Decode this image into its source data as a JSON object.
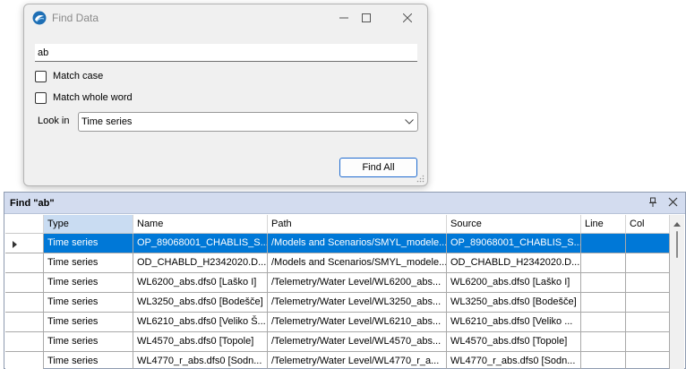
{
  "dialog": {
    "title": "Find Data",
    "search_value": "ab",
    "match_case_label": "Match case",
    "match_whole_word_label": "Match whole word",
    "look_in_label": "Look in",
    "look_in_value": "Time series",
    "find_all_label": "Find All"
  },
  "panel": {
    "title": "Find \"ab\"",
    "columns": [
      "Type",
      "Name",
      "Path",
      "Source",
      "Line",
      "Col"
    ],
    "rows": [
      {
        "type": "Time series",
        "name": "OP_89068001_CHABLIS_S...",
        "path": "/Models and Scenarios/SMYL_modele...",
        "source": "OP_89068001_CHABLIS_S...",
        "line": "",
        "col": ""
      },
      {
        "type": "Time series",
        "name": "OD_CHABLD_H2342020.D...",
        "path": "/Models and Scenarios/SMYL_modele...",
        "source": "OD_CHABLD_H2342020.D...",
        "line": "",
        "col": ""
      },
      {
        "type": "Time series",
        "name": "WL6200_abs.dfs0 [Laško I]",
        "path": "/Telemetry/Water Level/WL6200_abs...",
        "source": "WL6200_abs.dfs0 [Laško I]",
        "line": "",
        "col": ""
      },
      {
        "type": "Time series",
        "name": "WL3250_abs.dfs0 [Bodešče]",
        "path": "/Telemetry/Water Level/WL3250_abs...",
        "source": "WL3250_abs.dfs0 [Bodešče]",
        "line": "",
        "col": ""
      },
      {
        "type": "Time series",
        "name": "WL6210_abs.dfs0 [Veliko Š...",
        "path": "/Telemetry/Water Level/WL6210_abs...",
        "source": "WL6210_abs.dfs0 [Veliko ...",
        "line": "",
        "col": ""
      },
      {
        "type": "Time series",
        "name": "WL4570_abs.dfs0 [Topole]",
        "path": "/Telemetry/Water Level/WL4570_abs...",
        "source": "WL4570_abs.dfs0 [Topole]",
        "line": "",
        "col": ""
      },
      {
        "type": "Time series",
        "name": "WL4770_r_abs.dfs0 [Sodn...",
        "path": "/Telemetry/Water Level/WL4770_r_a...",
        "source": "WL4770_r_abs.dfs0 [Sodn...",
        "line": "",
        "col": ""
      }
    ]
  },
  "colors": {
    "selection": "#0078d7",
    "header_sorted": "#c9dcf2",
    "panel_header": "#d3dcef",
    "dialog_bg": "#f0f0f0"
  }
}
